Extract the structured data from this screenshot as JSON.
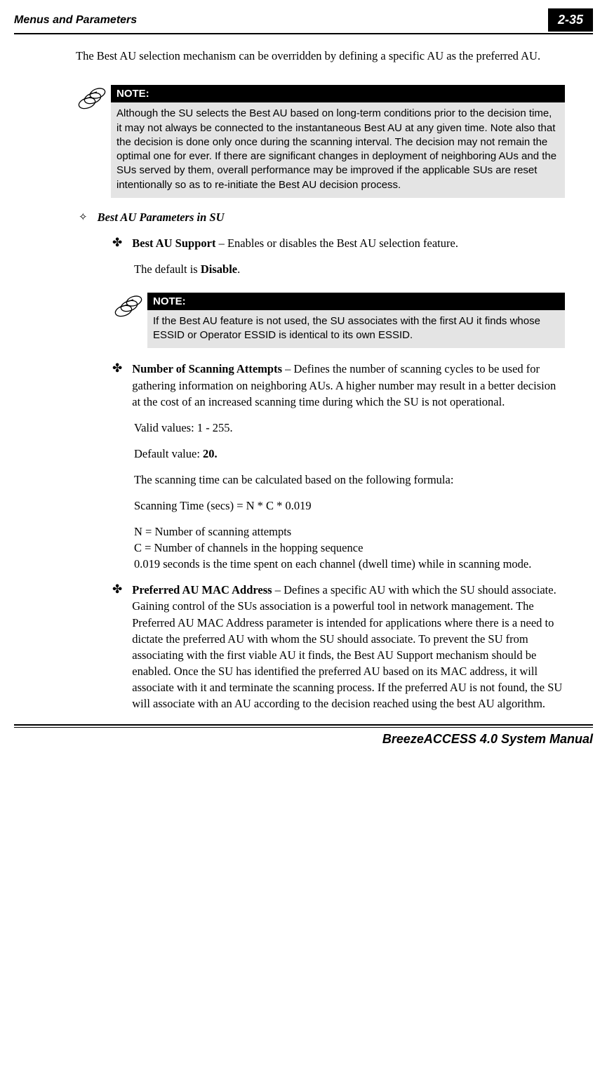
{
  "header": {
    "section": "Menus and Parameters",
    "pageref": "2-35"
  },
  "intro": "The Best AU selection mechanism can be overridden by defining a specific AU as the preferred AU.",
  "note1": {
    "label": "NOTE:",
    "body": "Although the SU selects the Best AU based on long-term conditions prior to the decision time, it may not always be connected to the instantaneous Best AU at any given time. Note also that the decision is done only once during the scanning interval. The decision may not remain the optimal one for ever. If there are significant changes in deployment of neighboring AUs and the SUs served by them, overall performance may be improved if the applicable SUs are reset intentionally so as to re-initiate the Best AU decision process."
  },
  "section1": {
    "title": "Best AU Parameters in SU"
  },
  "item1": {
    "title": "Best AU Support",
    "desc": " – Enables or disables the Best AU selection feature.",
    "default_pre": "The default is ",
    "default_val": "Disable",
    "default_post": "."
  },
  "note2": {
    "label": "NOTE:",
    "body": "If the Best AU feature is not used, the SU associates with the first AU it  finds whose ESSID or Operator ESSID is identical to its own ESSID."
  },
  "item2": {
    "title": "Number of Scanning Attempts",
    "desc": " – Defines the number of scanning cycles to be used for gathering information on neighboring AUs. A higher number may result in a better decision at the cost of an increased scanning time during which the SU is not operational.",
    "valid": "Valid values: 1 - 255.",
    "default_pre": "Default value: ",
    "default_val": "20.",
    "calc_intro": "The scanning time can be calculated based on the following formula:",
    "formula": "Scanning Time (secs) = N * C * 0.019",
    "line_n": "N = Number of scanning attempts",
    "line_c": "C =  Number of channels in the hopping sequence",
    "line_dwell": "0.019 seconds is the time spent on each channel (dwell time) while in scanning mode."
  },
  "item3": {
    "title": "Preferred AU MAC Address",
    "desc": " – Defines a specific AU with which the SU should associate. Gaining control of the SUs association is a powerful tool in network management. The Preferred AU MAC Address parameter is intended for applications where there is a need to dictate the preferred AU with whom the SU should associate. To prevent the SU from associating with the first viable AU it finds, the Best AU Support mechanism should be enabled. Once the SU has identified the preferred AU based on its MAC address, it will associate with it and terminate the scanning process. If the preferred AU is not found, the SU will associate with an AU according to the decision reached using the best AU algorithm."
  },
  "footer": "BreezeACCESS 4.0 System Manual"
}
